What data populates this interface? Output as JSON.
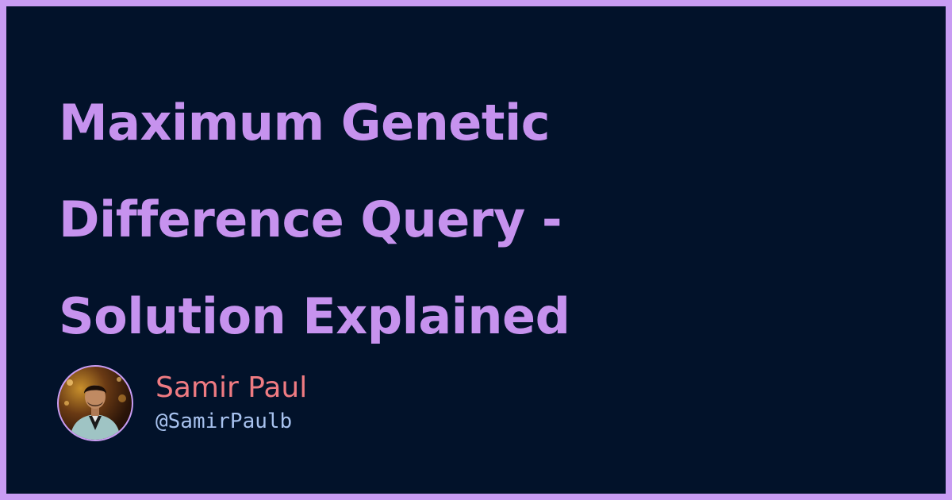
{
  "title_lines": [
    "Maximum Genetic",
    "Difference Query -",
    "Solution Explained"
  ],
  "author": {
    "name": "Samir Paul",
    "handle": "@SamirPaulb"
  },
  "colors": {
    "frame": "#c89cf2",
    "background": "#02122a",
    "title": "#c692ee",
    "name": "#ef7b82",
    "handle": "#a8c2ef"
  }
}
